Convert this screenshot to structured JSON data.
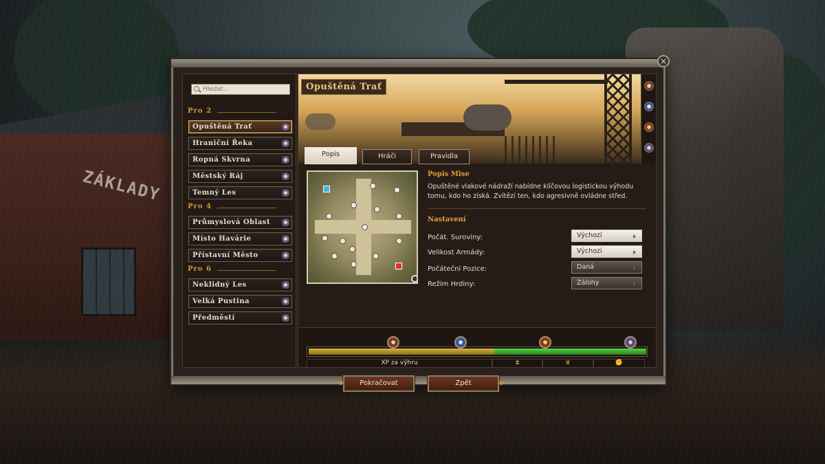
{
  "search": {
    "placeholder": "Hledat..."
  },
  "map_groups": [
    {
      "heading": "Pro 2",
      "maps": [
        "Opuštěná Trať",
        "Hraniční Řeka",
        "Ropná Skvrna",
        "Městský Ráj",
        "Temný Les"
      ]
    },
    {
      "heading": "Pro 4",
      "maps": [
        "Průmyslová Oblast",
        "Místo Havárie",
        "Přístavní Město"
      ]
    },
    {
      "heading": "Pro 6",
      "maps": [
        "Neklidný Les",
        "Velká Pustina",
        "Předměstí"
      ]
    }
  ],
  "selected_map": "Opuštěná Trať",
  "hero": {
    "title": "Opuštěná Trať"
  },
  "tabs": [
    "Popis",
    "Hráči",
    "Pravidla"
  ],
  "active_tab": "Popis",
  "mission": {
    "heading": "Popis Mise",
    "text": "Opuštěné vlakové nádraží nabídne klíčovou logistickou výhodu tomu, kdo ho získá. Zvítězí ten, kdo agresivně ovládne střed."
  },
  "settings": {
    "heading": "Nastavení",
    "rows": [
      {
        "label": "Počát. Suroviny:",
        "value": "Výchozí"
      },
      {
        "label": "Velikost Armády:",
        "value": "Výchozí"
      },
      {
        "label": "Počáteční Pozice:",
        "value": "Daná"
      },
      {
        "label": "Režim Hrdiny:",
        "value": "Zálohy"
      }
    ]
  },
  "xp": {
    "label": "XP za výhru",
    "gold_fraction": 0.55,
    "green_fraction": 0.45,
    "icons": [
      "hourglass-icon",
      "podium-icon",
      "gauntlet-icon"
    ]
  },
  "buttons": {
    "continue": "Pokračovat",
    "back": "Zpět"
  },
  "close_label": "×",
  "colors": {
    "accent_orange": "#e0a040",
    "selected_map": "#5a3a22",
    "xp_gold": "#d4b040",
    "xp_green": "#58d048"
  }
}
